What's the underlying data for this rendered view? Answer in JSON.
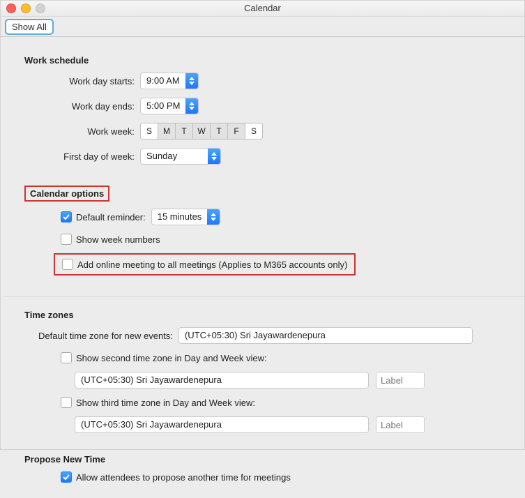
{
  "window": {
    "title": "Calendar",
    "show_all": "Show All"
  },
  "work_schedule": {
    "heading": "Work schedule",
    "starts_label": "Work day starts:",
    "starts_value": "9:00 AM",
    "ends_label": "Work day ends:",
    "ends_value": "5:00 PM",
    "week_label": "Work week:",
    "days": [
      "S",
      "M",
      "T",
      "W",
      "T",
      "F",
      "S"
    ],
    "days_selected": [
      false,
      true,
      true,
      true,
      true,
      true,
      false
    ],
    "first_day_label": "First day of week:",
    "first_day_value": "Sunday"
  },
  "calendar_options": {
    "heading": "Calendar options",
    "default_reminder_checked": true,
    "default_reminder_label": "Default reminder:",
    "default_reminder_value": "15 minutes",
    "show_week_numbers_checked": false,
    "show_week_numbers_label": "Show week numbers",
    "add_online_meeting_checked": false,
    "add_online_meeting_label": "Add online meeting to all meetings (Applies to M365 accounts only)"
  },
  "time_zones": {
    "heading": "Time zones",
    "default_label": "Default time zone for new events:",
    "default_value": "(UTC+05:30) Sri Jayawardenepura",
    "second_checked": false,
    "second_label": "Show second time zone in Day and Week view:",
    "second_value": "(UTC+05:30) Sri Jayawardenepura",
    "second_label_placeholder": "Label",
    "third_checked": false,
    "third_label": "Show third time zone in Day and Week view:",
    "third_value": "(UTC+05:30) Sri Jayawardenepura",
    "third_label_placeholder": "Label"
  },
  "propose": {
    "heading": "Propose New Time",
    "allow_checked": true,
    "allow_label": "Allow attendees to propose another time for meetings"
  }
}
